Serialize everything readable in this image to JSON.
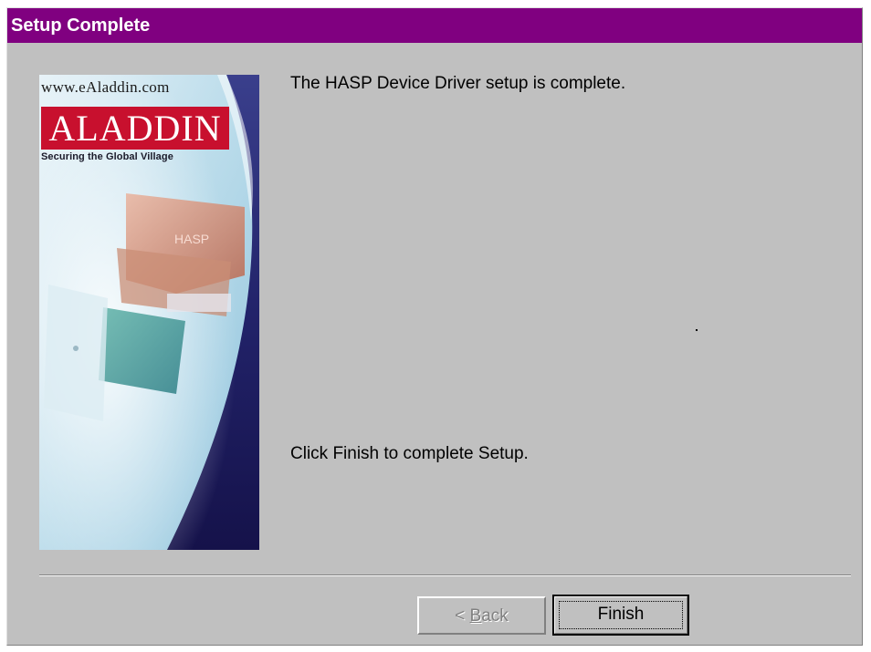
{
  "window": {
    "title": "Setup Complete",
    "title_bar_color": "#800080",
    "background_color": "#c0c0c0"
  },
  "banner": {
    "url": "www.eAladdin.com",
    "logo": "ALADDIN",
    "tagline": "Securing the Global Village",
    "product_label": "HASP",
    "logo_color": "#c8102e"
  },
  "main": {
    "message_top": "The HASP Device Driver setup is complete.",
    "message_bottom": "Click Finish to complete Setup."
  },
  "buttons": {
    "back": {
      "prefix": "< ",
      "accel": "B",
      "rest": "ack",
      "enabled": false
    },
    "finish": {
      "label": "Finish",
      "default": true
    }
  }
}
